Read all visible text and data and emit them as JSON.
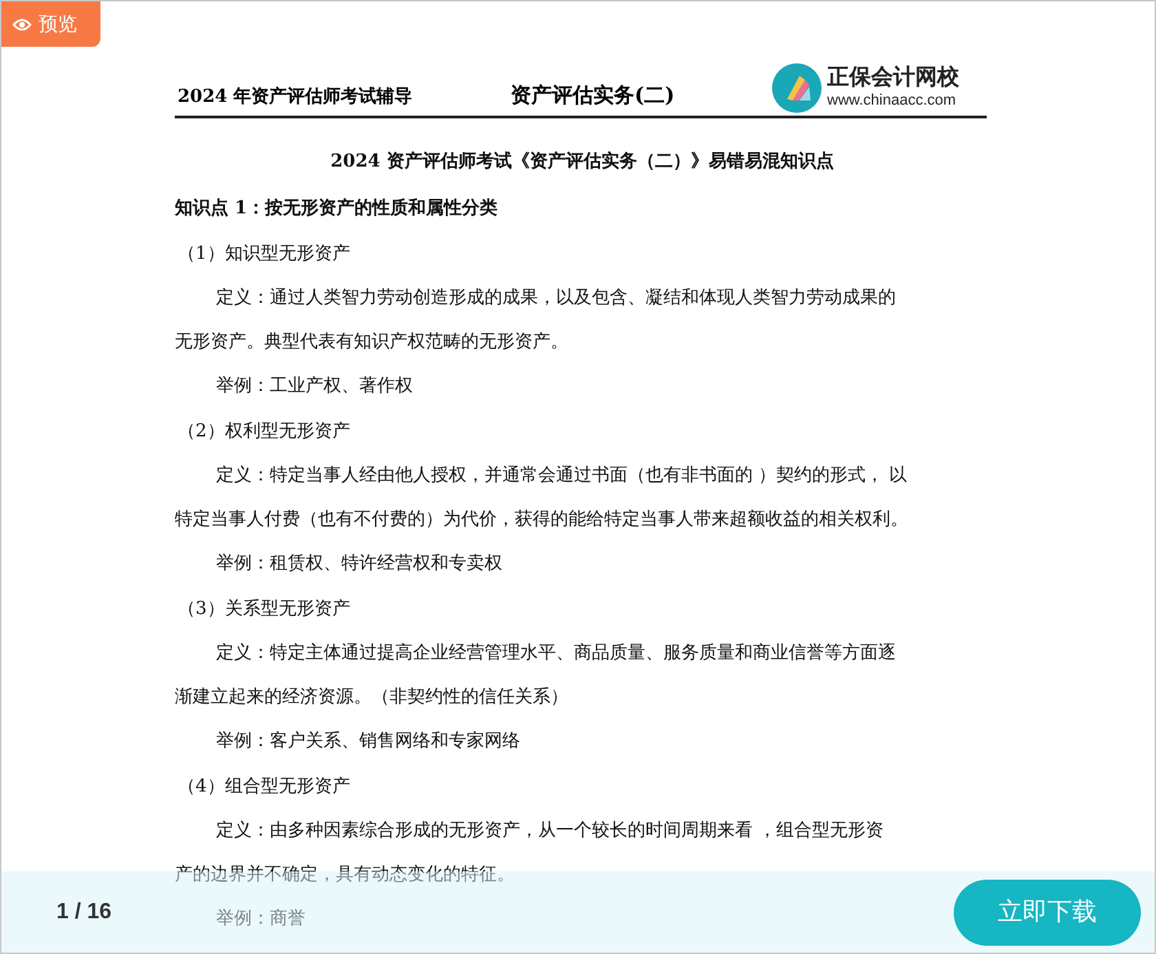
{
  "preview_tag": {
    "label": "预览"
  },
  "header": {
    "series": "2024 年资产评估师考试辅导",
    "subject": "资产评估实务(二)",
    "logo_name": "正保会计网校",
    "logo_url": "www.chinaacc.com"
  },
  "document": [
    {
      "kind": "title",
      "lines": [
        "2024 资产评估师考试《资产评估实务（二）》易错易混知识点"
      ]
    },
    {
      "kind": "heading",
      "lines": [
        "知识点 1：按无形资产的性质和属性分类"
      ]
    },
    {
      "kind": "item",
      "lines": [
        "（1）知识型无形资产"
      ]
    },
    {
      "kind": "para",
      "lines": [
        "定义：通过人类智力劳动创造形成的成果，以及包含、凝结和体现人类智力劳动成果的",
        "无形资产。典型代表有知识产权范畴的无形资产。"
      ]
    },
    {
      "kind": "para",
      "lines": [
        "举例：工业产权、著作权"
      ]
    },
    {
      "kind": "item",
      "lines": [
        "（2）权利型无形资产"
      ]
    },
    {
      "kind": "para",
      "lines": [
        "定义：特定当事人经由他人授权，并通常会通过书面（也有非书面的 ）契约的形式， 以",
        "特定当事人付费（也有不付费的）为代价，获得的能给特定当事人带来超额收益的相关权利。"
      ]
    },
    {
      "kind": "para",
      "lines": [
        "举例：租赁权、特许经营权和专卖权"
      ]
    },
    {
      "kind": "item",
      "lines": [
        "（3）关系型无形资产"
      ]
    },
    {
      "kind": "para",
      "lines": [
        "定义：特定主体通过提高企业经营管理水平、商品质量、服务质量和商业信誉等方面逐",
        "渐建立起来的经济资源。（非契约性的信任关系）"
      ]
    },
    {
      "kind": "para",
      "lines": [
        "举例：客户关系、销售网络和专家网络"
      ]
    },
    {
      "kind": "item",
      "lines": [
        "（4）组合型无形资产"
      ]
    },
    {
      "kind": "para",
      "lines": [
        "定义：由多种因素综合形成的无形资产，从一个较长的时间周期来看 ，组合型无形资",
        "产的边界并不确定，具有动态变化的特征。"
      ]
    },
    {
      "kind": "para",
      "lines": [
        "举例：商誉"
      ]
    }
  ],
  "footer": {
    "page_counter": "1 / 16",
    "download_button": "立即下载"
  }
}
